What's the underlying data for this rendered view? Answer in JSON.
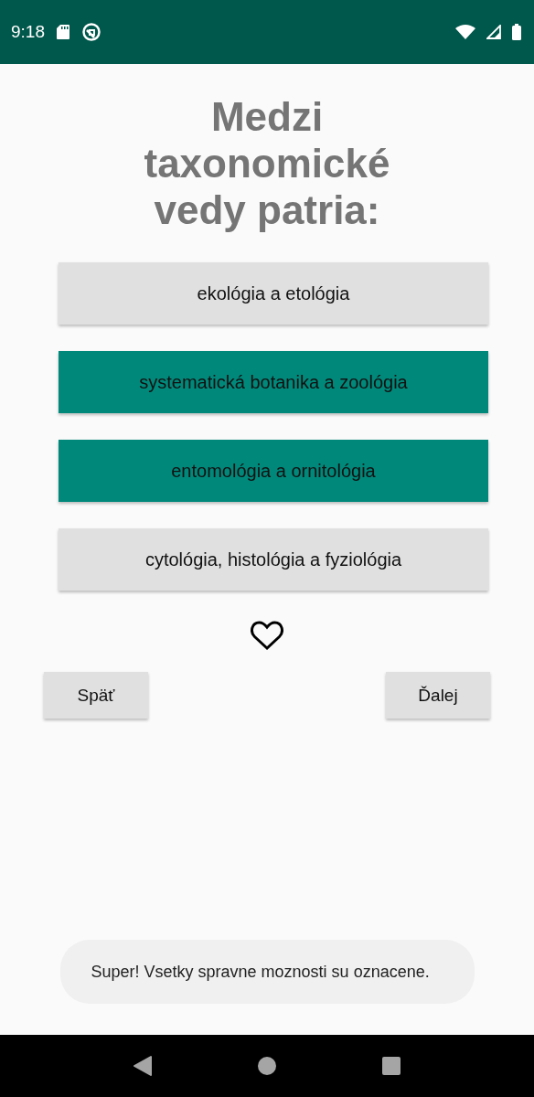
{
  "status_bar": {
    "time": "9:18"
  },
  "question": "Medzi taxonomické vedy patria:",
  "answers": [
    {
      "label": "ekológia a etológia",
      "selected": false
    },
    {
      "label": "systematická botanika a zoológia",
      "selected": true
    },
    {
      "label": "entomológia a ornitológia",
      "selected": true
    },
    {
      "label": "cytológia, histológia a fyziológia",
      "selected": false
    }
  ],
  "favorite": false,
  "buttons": {
    "back": "Späť",
    "next": "Ďalej"
  },
  "toast": "Super! Vsetky spravne moznosti su oznacene."
}
